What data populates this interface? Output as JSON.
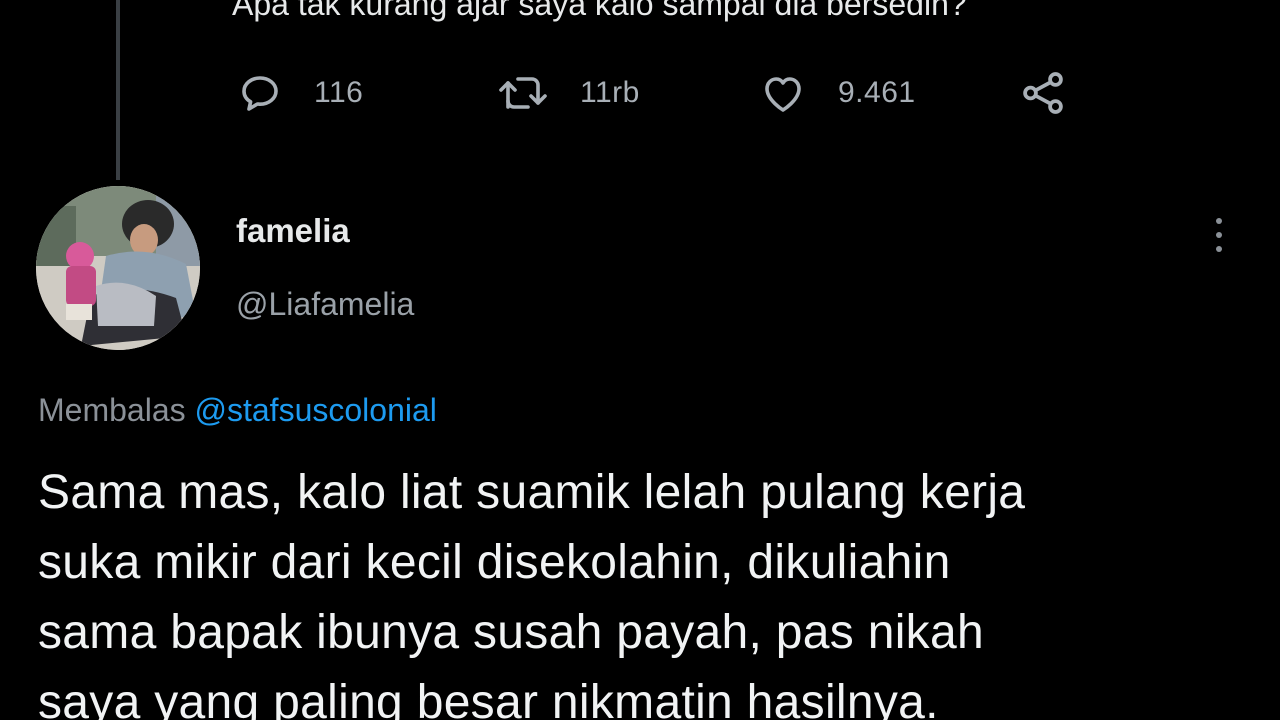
{
  "previous_tweet": {
    "text": "Apa tak kurang ajar saya kalo sampai dia bersedih?",
    "reply_count": "116",
    "retweet_count": "11rb",
    "like_count": "9.461"
  },
  "reply_tweet": {
    "display_name": "famelia",
    "handle": "@Liafamelia",
    "replying_label": "Membalas",
    "replying_to": "@stafsuscolonial",
    "body_lines": [
      "Sama mas, kalo liat suamik lelah pulang kerja",
      "suka mikir dari kecil disekolahin, dikuliahin",
      "sama bapak ibunya susah payah, pas nikah",
      "saya yang paling besar nikmatin hasilnya."
    ]
  },
  "icons": {
    "reply": "reply-icon",
    "retweet": "retweet-icon",
    "like": "heart-icon",
    "share": "share-icon",
    "more": "more-vertical-icon"
  },
  "colors": {
    "background": "#000000",
    "text": "#e7e9ea",
    "secondary_text": "#8b9198",
    "link": "#1d9bf0"
  }
}
